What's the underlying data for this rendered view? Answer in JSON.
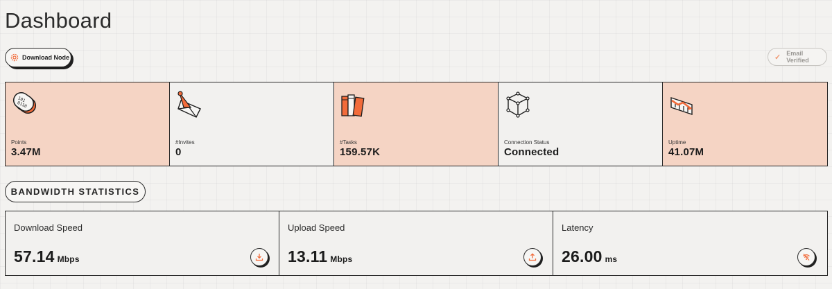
{
  "page": {
    "title": "Dashboard"
  },
  "header": {
    "download_node_label": "Download Node",
    "email_verified_label": "Email Verified"
  },
  "stats": [
    {
      "label": "Points",
      "value": "3.47M",
      "icon": "binary-capsule-icon"
    },
    {
      "label": "#Invites",
      "value": "0",
      "icon": "envelope-icon"
    },
    {
      "label": "#Tasks",
      "value": "159.57K",
      "icon": "books-icon"
    },
    {
      "label": "Connection Status",
      "value": "Connected",
      "icon": "network-cube-icon"
    },
    {
      "label": "Uptime",
      "value": "41.07M",
      "icon": "trend-chart-icon"
    }
  ],
  "bandwidth": {
    "section_label": "BANDWIDTH STATISTICS",
    "cards": [
      {
        "label": "Download Speed",
        "value": "57.14",
        "unit": "Mbps",
        "icon": "download-icon"
      },
      {
        "label": "Upload Speed",
        "value": "13.11",
        "unit": "Mbps",
        "icon": "upload-icon"
      },
      {
        "label": "Latency",
        "value": "26.00",
        "unit": "ms",
        "icon": "wifi-off-icon"
      }
    ]
  },
  "colors": {
    "accent": "#f26b3a",
    "accent_bg": "#f5d4c4",
    "panel": "#f2f1ef"
  }
}
